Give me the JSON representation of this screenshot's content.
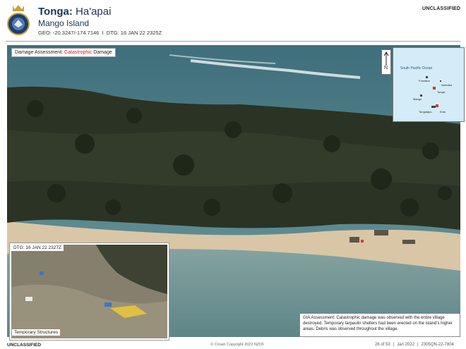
{
  "header": {
    "country": "Tonga:",
    "region": "Ha'apai",
    "island": "Mango Island",
    "geo_label": "GEO:",
    "geo_value": "-20.3247/-174.7146",
    "separator": "I",
    "dtg_label": "DTG:",
    "dtg_value": "16 JAN 22 2325Z",
    "classification": "UNCLASSIFIED"
  },
  "photo": {
    "assessment_prefix": "Damage Assessment:",
    "assessment_level": "Catastrophic",
    "assessment_suffix": "Damage",
    "north_letter": "N",
    "inset_map": {
      "ocean_label": "South Pacific Ocean",
      "places": [
        "Fonoifua",
        "Nomuka",
        "Mango",
        "Tonga",
        "Tongatapu",
        "Kotu"
      ]
    },
    "inset_photo": {
      "dtg": "DTG: 16 JAN 22 2327Z",
      "caption": "Temporary Structures"
    },
    "gia_text": "GIA Assessment: Catastrophic damage was observed with the entire village destroyed. Temporary tarpaulin shelters had been erected on the island's higher areas. Debris was observed throughout the village."
  },
  "footer": {
    "classification": "UNCLASSIFIED",
    "copyright": "© Crown Copyright 2022 NZDF",
    "page": "26 of 53",
    "date": "Jan 2022",
    "ref": "2305QN-22-7804"
  },
  "colors": {
    "title": "#1d3457",
    "catastrophic": "#c0272d",
    "sea": "#4f7e86",
    "sand": "#d9c6a6",
    "foliage": "#2b3324"
  }
}
